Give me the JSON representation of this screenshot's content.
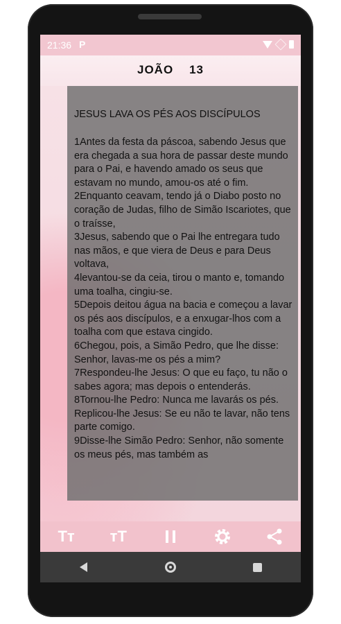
{
  "status": {
    "time": "21:36",
    "app_icon": "P"
  },
  "header": {
    "book": "JOÃO",
    "chapter": "13"
  },
  "content": {
    "heading": "JESUS LAVA OS PÉS AOS DISCÍPULOS",
    "verses": [
      "1Antes da festa da páscoa, sabendo Jesus que era chegada a sua hora de passar deste mundo para o Pai, e havendo amado os seus que estavam no mundo, amou-os até o fim.",
      "2Enquanto ceavam, tendo já o Diabo posto no coração de Judas, filho de Simão Iscariotes, que o traísse,",
      "3Jesus, sabendo que o Pai lhe entregara tudo nas mãos, e que viera de Deus e para Deus voltava,",
      "4levantou-se da ceia, tirou o manto e, tomando uma toalha, cingiu-se.",
      "5Depois deitou água na bacia e começou a lavar os pés aos discípulos, e a enxugar-lhos com a toalha com que estava cingido.",
      "6Chegou, pois, a Simão Pedro, que lhe disse: Senhor, lavas-me os pés a mim?",
      "7Respondeu-lhe Jesus: O que eu faço, tu não o sabes agora; mas depois o entenderás.",
      "8Tornou-lhe Pedro: Nunca me lavarás os pés. Replicou-lhe Jesus: Se eu não te lavar, não tens parte comigo.",
      "9Disse-lhe Simão Pedro: Senhor, não somente os meus pés, mas também as"
    ]
  },
  "toolbar": {
    "decrease_font": "Tт",
    "increase_font": "тT"
  },
  "icons": [
    "decrease-font-icon",
    "increase-font-icon",
    "pause-icon",
    "settings-icon",
    "share-icon"
  ],
  "colors": {
    "accent": "#f2c2cc",
    "panel": "#6e6e6e"
  }
}
